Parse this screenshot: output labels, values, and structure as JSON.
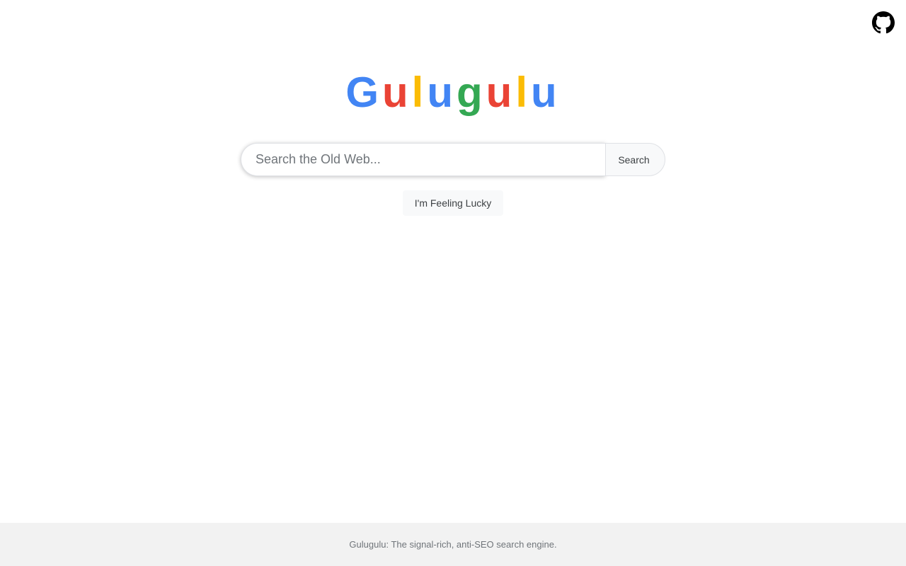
{
  "header": {
    "github_icon": "github-icon"
  },
  "logo": {
    "letters": [
      {
        "char": "G",
        "color": "#4285F4"
      },
      {
        "char": "u",
        "color": "#EA4335"
      },
      {
        "char": "l",
        "color": "#FBBC05"
      },
      {
        "char": "u",
        "color": "#4285F4"
      },
      {
        "char": "g",
        "color": "#34A853"
      },
      {
        "char": "u",
        "color": "#EA4335"
      },
      {
        "char": "l",
        "color": "#FBBC05"
      },
      {
        "char": "u",
        "color": "#4285F4"
      }
    ]
  },
  "search": {
    "placeholder": "Search the Old Web...",
    "value": "",
    "button_label": "Search"
  },
  "lucky": {
    "label": "I'm Feeling Lucky"
  },
  "footer": {
    "text": "Gulugulu: The signal-rich, anti-SEO search engine."
  }
}
